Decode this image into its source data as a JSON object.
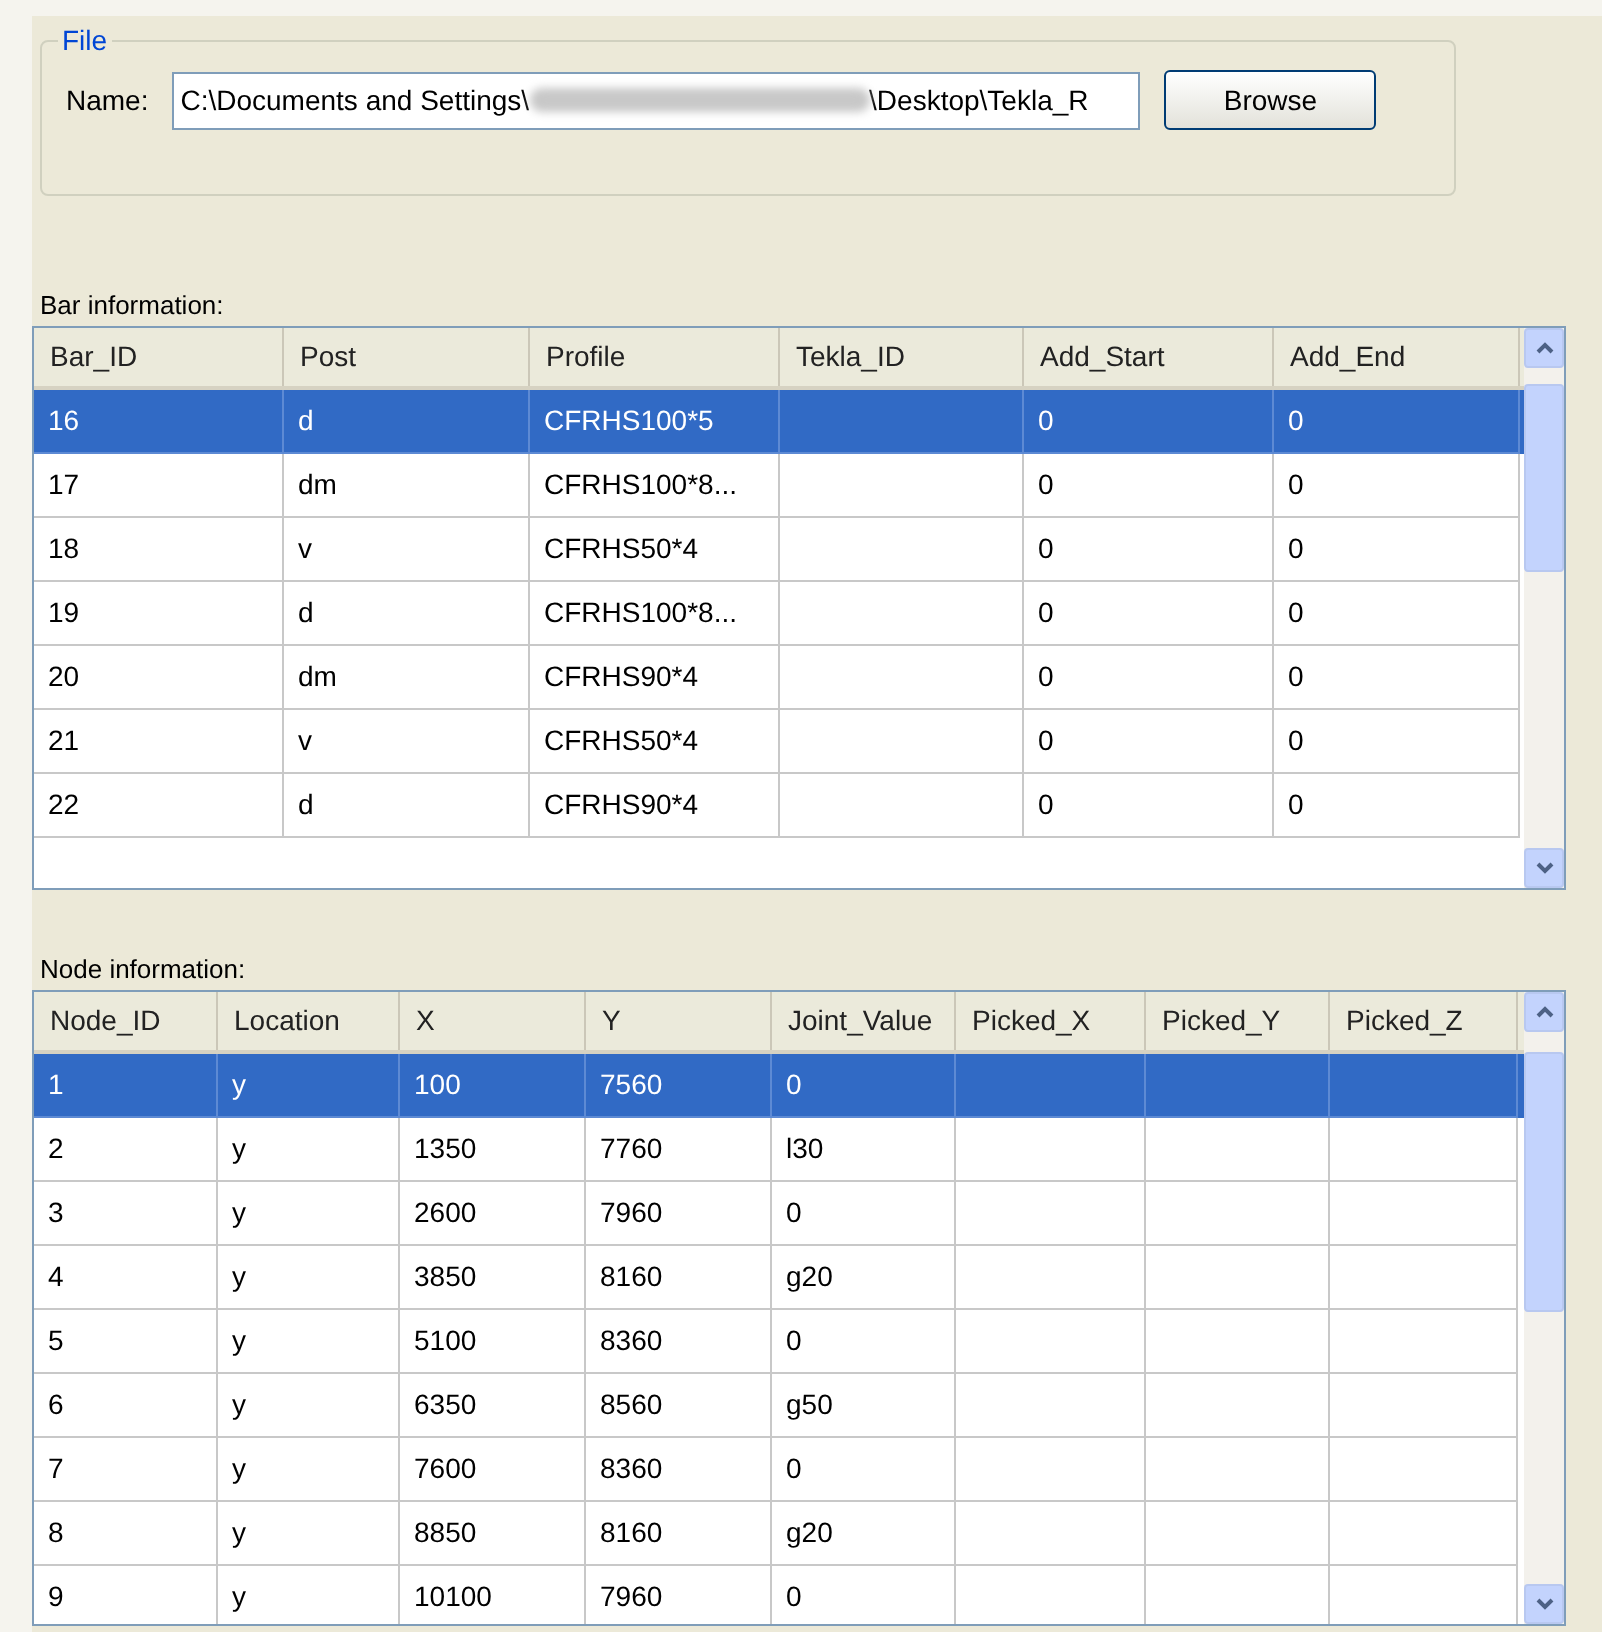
{
  "file_group": {
    "title": "File",
    "name_label": "Name:",
    "path_start": "C:\\Documents and Settings\\",
    "path_end": "\\Desktop\\Tekla_R",
    "browse_button": "Browse"
  },
  "bar_table": {
    "label": "Bar information:",
    "columns": [
      "Bar_ID",
      "Post",
      "Profile",
      "Tekla_ID",
      "Add_Start",
      "Add_End"
    ],
    "rows": [
      {
        "selected": true,
        "cells": [
          "16",
          "d",
          "CFRHS100*5",
          "",
          "0",
          "0"
        ]
      },
      {
        "selected": false,
        "cells": [
          "17",
          "dm",
          "CFRHS100*8...",
          "",
          "0",
          "0"
        ]
      },
      {
        "selected": false,
        "cells": [
          "18",
          "v",
          "CFRHS50*4",
          "",
          "0",
          "0"
        ]
      },
      {
        "selected": false,
        "cells": [
          "19",
          "d",
          "CFRHS100*8...",
          "",
          "0",
          "0"
        ]
      },
      {
        "selected": false,
        "cells": [
          "20",
          "dm",
          "CFRHS90*4",
          "",
          "0",
          "0"
        ]
      },
      {
        "selected": false,
        "cells": [
          "21",
          "v",
          "CFRHS50*4",
          "",
          "0",
          "0"
        ]
      },
      {
        "selected": false,
        "cells": [
          "22",
          "d",
          "CFRHS90*4",
          "",
          "0",
          "0"
        ]
      }
    ]
  },
  "node_table": {
    "label": "Node information:",
    "columns": [
      "Node_ID",
      "Location",
      "X",
      "Y",
      "Joint_Value",
      "Picked_X",
      "Picked_Y",
      "Picked_Z"
    ],
    "rows": [
      {
        "selected": true,
        "cells": [
          "1",
          "y",
          "100",
          "7560",
          "0",
          "",
          "",
          ""
        ]
      },
      {
        "selected": false,
        "cells": [
          "2",
          "y",
          "1350",
          "7760",
          "l30",
          "",
          "",
          ""
        ]
      },
      {
        "selected": false,
        "cells": [
          "3",
          "y",
          "2600",
          "7960",
          "0",
          "",
          "",
          ""
        ]
      },
      {
        "selected": false,
        "cells": [
          "4",
          "y",
          "3850",
          "8160",
          "g20",
          "",
          "",
          ""
        ]
      },
      {
        "selected": false,
        "cells": [
          "5",
          "y",
          "5100",
          "8360",
          "0",
          "",
          "",
          ""
        ]
      },
      {
        "selected": false,
        "cells": [
          "6",
          "y",
          "6350",
          "8560",
          "g50",
          "",
          "",
          ""
        ]
      },
      {
        "selected": false,
        "cells": [
          "7",
          "y",
          "7600",
          "8360",
          "0",
          "",
          "",
          ""
        ]
      },
      {
        "selected": false,
        "cells": [
          "8",
          "y",
          "8850",
          "8160",
          "g20",
          "",
          "",
          ""
        ]
      },
      {
        "selected": false,
        "cells": [
          "9",
          "y",
          "10100",
          "7960",
          "0",
          "",
          "",
          ""
        ]
      }
    ]
  }
}
